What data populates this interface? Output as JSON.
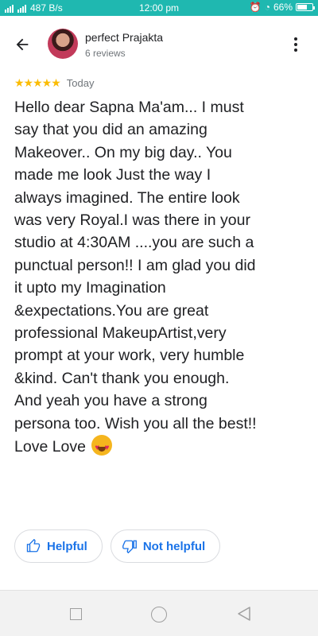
{
  "status_bar": {
    "network_speed": "487 B/s",
    "time": "12:00 pm",
    "battery": "66%",
    "battery_level": 0.66
  },
  "header": {
    "user_name": "perfect Prajakta",
    "review_count": "6 reviews"
  },
  "review": {
    "stars": "★★★★★",
    "rating": 5,
    "date": "Today",
    "text": "Hello dear Sapna Ma'am... I must\nsay that you did an amazing\nMakeover.. On my big day.. You\nmade me look Just  the way I\nalways  imagined. The entire look\nwas very Royal.I was there in your\nstudio at 4:30AM ....you are such a\npunctual person!! I am glad you did\nit upto my Imagination\n&expectations.You are great\nprofessional MakeupArtist,very\nprompt  at your work, very  humble\n&kind. Can't thank you enough.\nAnd yeah you have a strong\npersona too. Wish you all the best!!\nLove Love "
  },
  "actions": {
    "helpful_label": "Helpful",
    "not_helpful_label": "Not helpful"
  },
  "colors": {
    "status_bar": "#1fb8b0",
    "accent": "#1a73e8",
    "star": "#fbbc04"
  }
}
